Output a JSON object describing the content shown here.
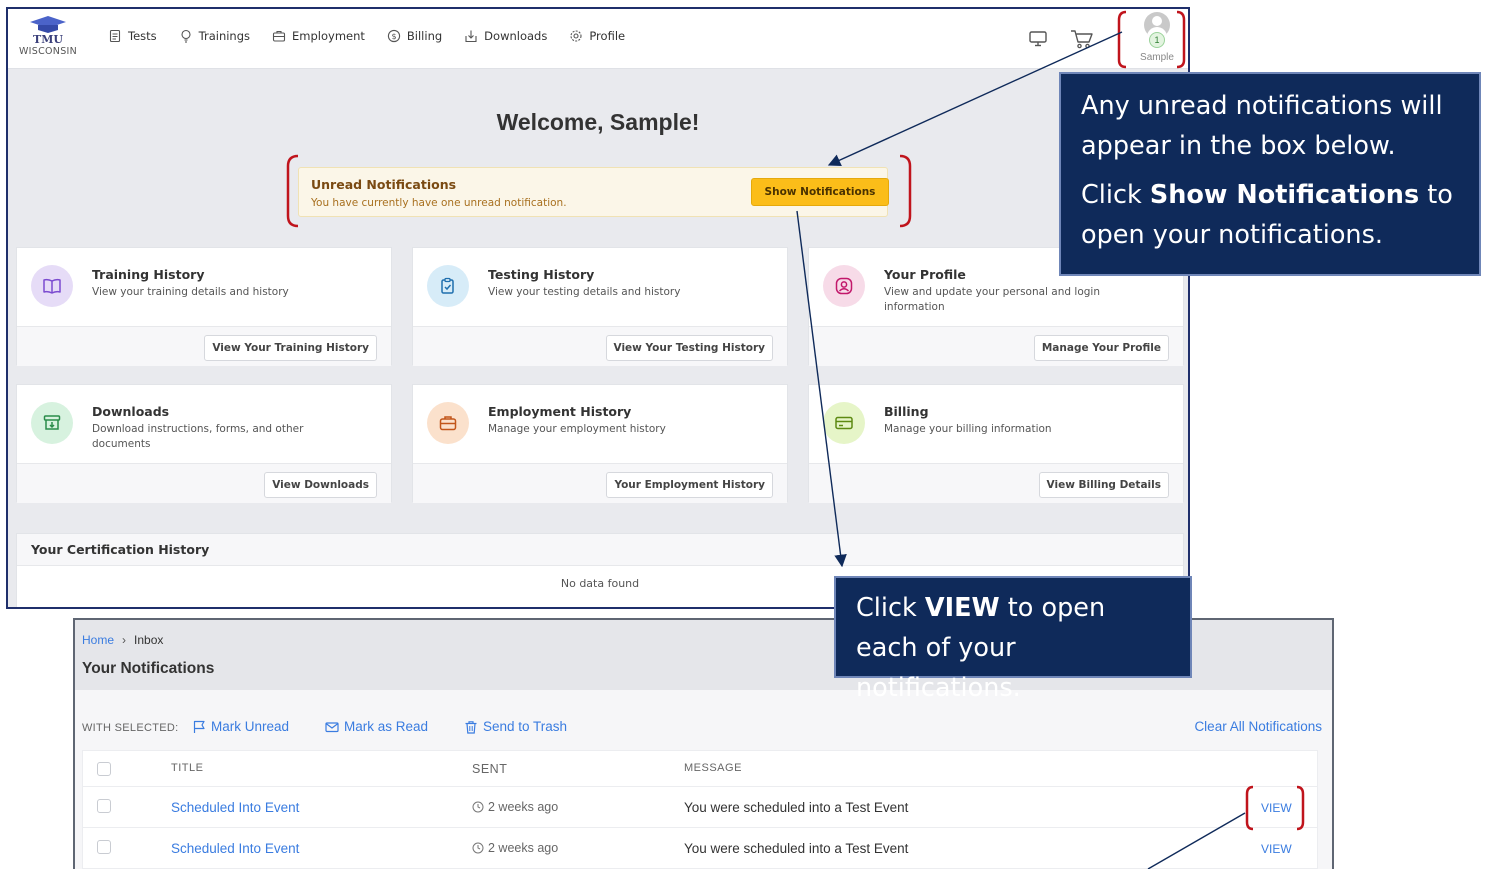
{
  "app": {
    "logo_main": "TMU",
    "logo_sub": "WISCONSIN",
    "nav": [
      {
        "label": "Tests",
        "icon": "document-icon"
      },
      {
        "label": "Trainings",
        "icon": "lightbulb-icon"
      },
      {
        "label": "Employment",
        "icon": "briefcase-icon"
      },
      {
        "label": "Billing",
        "icon": "dollar-icon"
      },
      {
        "label": "Downloads",
        "icon": "download-icon"
      },
      {
        "label": "Profile",
        "icon": "gear-icon"
      }
    ],
    "user_name": "Sample",
    "notification_count": "1"
  },
  "dashboard": {
    "welcome": "Welcome, Sample!",
    "notifications": {
      "title": "Unread Notifications",
      "text": "You have currently have one unread notification.",
      "button": "Show Notifications"
    },
    "cards": [
      {
        "title": "Training History",
        "desc": "View your training details and history",
        "button": "View Your Training History",
        "icon": "book-icon",
        "color": "#e6dcf7",
        "icon_color": "#7b4bd0"
      },
      {
        "title": "Testing History",
        "desc": "View your testing details and history",
        "button": "View Your Testing History",
        "icon": "clipboard-check-icon",
        "color": "#d7ecf8",
        "icon_color": "#1f6fae"
      },
      {
        "title": "Your Profile",
        "desc": "View and update your personal and login information",
        "button": "Manage Your Profile",
        "icon": "user-circle-icon",
        "color": "#f7dbe8",
        "icon_color": "#c2186b"
      },
      {
        "title": "Downloads",
        "desc": "Download instructions, forms, and other documents",
        "button": "View Downloads",
        "icon": "archive-download-icon",
        "color": "#d7f2df",
        "icon_color": "#2a8c4a"
      },
      {
        "title": "Employment History",
        "desc": "Manage your employment history",
        "button": "Your Employment History",
        "icon": "briefcase-icon",
        "color": "#fbe1cc",
        "icon_color": "#c2561a"
      },
      {
        "title": "Billing",
        "desc": "Manage your billing information",
        "button": "View Billing Details",
        "icon": "credit-card-icon",
        "color": "#e6f5c8",
        "icon_color": "#5d8a12"
      }
    ],
    "certification": {
      "title": "Your Certification History",
      "empty": "No data found"
    }
  },
  "inbox": {
    "breadcrumb_home": "Home",
    "breadcrumb_current": "Inbox",
    "title": "Your Notifications",
    "with_selected": "WITH SELECTED:",
    "actions": [
      "Mark Unread",
      "Mark as Read",
      "Send to Trash"
    ],
    "clear_all": "Clear All Notifications",
    "columns": [
      "TITLE",
      "SENT",
      "MESSAGE"
    ],
    "rows": [
      {
        "title": "Scheduled Into Event",
        "sent": "2 weeks ago",
        "message": "You were scheduled into a Test Event",
        "action": "VIEW"
      },
      {
        "title": "Scheduled Into Event",
        "sent": "2 weeks ago",
        "message": "You were scheduled into a Test Event",
        "action": "VIEW"
      }
    ]
  },
  "callouts": {
    "one_line1": "Any unread notifications will appear in the box below.",
    "one_line2_pre": "Click ",
    "one_line2_bold": "Show Notifications",
    "one_line2_post": " to open your notifications.",
    "two_pre": "Click ",
    "two_bold": "VIEW",
    "two_post": " to open each of your notifications."
  },
  "colors": {
    "callout_bg": "#0f2a5a",
    "highlight_red": "#c0141c",
    "link_blue": "#3a7ce0",
    "button_yellow": "#fbbd19"
  }
}
